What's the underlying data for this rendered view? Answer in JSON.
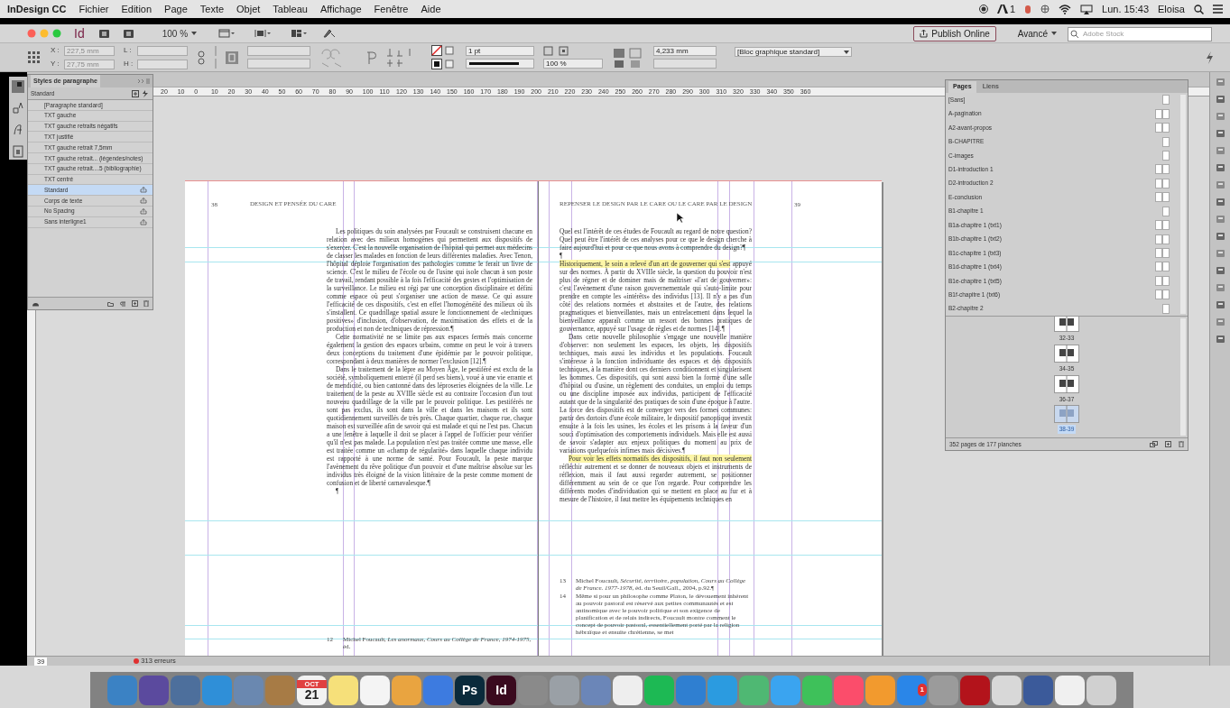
{
  "menubar": {
    "app": "InDesign CC",
    "items": [
      "Fichier",
      "Edition",
      "Page",
      "Texte",
      "Objet",
      "Tableau",
      "Affichage",
      "Fenêtre",
      "Aide"
    ],
    "badge": "1",
    "clock": "Lun. 15:43",
    "user": "Eloisa"
  },
  "titlebar": {
    "logo": "Id",
    "zoom": "100 %",
    "publish": "Publish Online",
    "workspace": "Avancé",
    "search": {
      "placeholder": "Adobe Stock"
    }
  },
  "control_panel": {
    "x": "227,5 mm",
    "y": "27,75 mm",
    "x_label": "X :",
    "y_label": "Y :",
    "w_label": "L :",
    "h_label": "H :",
    "stroke": "1 pt",
    "scale": "100 %",
    "offset": "4,233 mm",
    "object_style": "[Bloc graphique standard]"
  },
  "paragraph_styles": {
    "title": "Styles de paragraphe",
    "current": "Standard",
    "items": [
      {
        "label": "[Paragraphe standard]",
        "selected": false,
        "synced": false
      },
      {
        "label": "TXT gauche",
        "selected": false,
        "synced": false
      },
      {
        "label": "TXT gauche retraits négatifs",
        "selected": false,
        "synced": false
      },
      {
        "label": "TXT justifié",
        "selected": false,
        "synced": false
      },
      {
        "label": "TXT gauche retrait 7,5mm",
        "selected": false,
        "synced": false
      },
      {
        "label": "TXT gauche retrait... (légendes/notes)",
        "selected": false,
        "synced": false
      },
      {
        "label": "TXT gauche retrait....5 (bibliographie)",
        "selected": false,
        "synced": false
      },
      {
        "label": "TXT centré",
        "selected": false,
        "synced": false
      },
      {
        "label": "Standard",
        "selected": true,
        "synced": true
      },
      {
        "label": "Corps de texte",
        "selected": false,
        "synced": true
      },
      {
        "label": "No Spacing",
        "selected": false,
        "synced": true
      },
      {
        "label": "Sans interligne1",
        "selected": false,
        "synced": true
      }
    ]
  },
  "ruler": [
    "20",
    "10",
    "0",
    "10",
    "20",
    "30",
    "40",
    "50",
    "60",
    "70",
    "80",
    "90",
    "100",
    "110",
    "120",
    "130",
    "140",
    "150",
    "160",
    "170",
    "180",
    "190",
    "200",
    "210",
    "220",
    "230",
    "240",
    "250",
    "260",
    "270",
    "280",
    "290",
    "300",
    "310",
    "320",
    "330",
    "340",
    "350",
    "360"
  ],
  "spread": {
    "left": {
      "folio": "38",
      "running_head": "DESIGN ET PENSÉE DU CARE",
      "paragraphs": [
        {
          "text": "Les politiques du soin analysées par Foucault se construisent chacune en relation avec des milieux homogènes qui permettent aux dispositifs de s'exercer. C'est la nouvelle organisation de l'hôpital qui permet aux médecins de classer les malades en fonction de leurs différentes maladies. Avec Tenon, l'hôpital déploie l'organisation des pathologies comme le ferait un livre de science. C'est le milieu de l'école ou de l'usine qui isole chacun à son poste de travail, rendant possible à la fois l'efficacité des gestes et l'optimisation de la surveillance. Le milieu est régi par une conception disciplinaire et défini comme espace où peut s'organiser une action de masse. Ce qui assure l'efficacité de ces dispositifs, c'est en effet l'homogénéité des milieux où ils s'installent. Ce quadrillage spatial assure le fonctionnement de «techniques positives» d'inclusion, d'observation, de maximisation des effets et de la production et non de techniques de répression.¶"
        },
        {
          "text": "Cette normativité ne se limite pas aux espaces fermés mais concerne également la gestion des espaces urbains, comme on peut le voir à travers deux conceptions du traitement d'une épidémie par le pouvoir politique, correspondant à deux manières de normer l'exclusion [12].¶"
        },
        {
          "text": "Dans le traitement de la lèpre au Moyen Âge, le pestiféré est exclu de la société, symboliquement enterré (il perd ses biens), voué à une vie errante et de mendicité, ou bien cantonné dans des léproseries éloignées de la ville. Le traitement de la peste au XVIIIe siècle est au contraire l'occasion d'un tout nouveau quadrillage de la ville par le pouvoir politique. Les pestiférés ne sont pas exclus, ils sont dans la ville et dans les maisons et ils sont quotidiennement surveillés de très près. Chaque quartier, chaque rue, chaque maison est surveillée afin de savoir qui est malade et qui ne l'est pas. Chacun a une fenêtre à laquelle il doit se placer à l'appel de l'officier pour vérifier qu'il n'est pas malade. La population n'est pas traitée comme une masse, elle est traitée comme un «champ de régularité» dans laquelle chaque individu est rapporté à une norme de santé. Pour Foucault, la peste marque l'avènement du rêve politique d'un pouvoir et d'une maîtrise absolue sur les individus très éloigné de la vision littéraire de la peste comme moment de confusion et de liberté carnavalesque.¶"
        },
        {
          "text": "¶"
        }
      ],
      "footnotes": [
        {
          "number": "12",
          "text": "Michel Foucault, *Les anormaux, Cours au Collège de France, 1974-1975*, éd."
        }
      ]
    },
    "right": {
      "folio": "39",
      "running_head": "REPENSER LE DESIGN PAR LE CARE OU LE CARE PAR LE DESIGN",
      "paragraphs": [
        {
          "text": "Quel est l'intérêt de ces études de Foucault au regard de notre question? Quel peut être l'intérêt de ces analyses pour ce que le design cherche à faire aujourd'hui et pour ce que nous avons à comprendre du design?¶"
        },
        {
          "text": "¶"
        },
        {
          "lead": "Historiquement, le soin a relevé d'un art de gouverner qui s'est",
          "text": " appuyé sur des normes. À partir du XVIIIe siècle, la question du pouvoir n'est plus de régner et de dominer mais de maîtriser «l'art de gouverner»: c'est l'avènement d'une raison gouvernementale qui s'auto-limite pour prendre en compte les «intérêts» des individus [13]. Il n'y a pas d'un côté des relations normées et abstraites et de l'autre, des relations pragmatiques et bienveillantes, mais un entrelacement dans lequel la bienveillance apparaît comme un ressort des bonnes pratiques de gouvernance, appuyé sur l'usage de règles et de normes [14].¶"
        },
        {
          "text": "Dans cette nouvelle philosophie s'engage une nouvelle manière d'observer: non seulement les espaces, les objets, les dispositifs techniques, mais aussi les individus et les populations. Foucault s'intéresse à la fonction individuante des espaces et des dispositifs techniques, à la manière dont ces derniers conditionnent et singularisent les hommes. Ces dispositifs, qui sont aussi bien la forme d'une salle d'hôpital ou d'usine, un règlement des conduites, un emploi du temps ou une discipline imposée aux individus, participent de l'efficacité autant que de la singularité des pratiques de soin d'une époque à l'autre. La force des dispositifs est de converger vers des formes communes: partir des dortoirs d'une école militaire, le dispositif panoptique investit ensuite à la fois les usines, les écoles et les prisons à la faveur d'un souci d'optimisation des comportements individuels. Mais elle est aussi de savoir s'adapter aux enjeux politiques du moment au prix de variations quelquefois infimes mais décisives.¶"
        },
        {
          "lead": "Pour voir les effets normatifs des dispositifs, il faut non seulement",
          "text": " réfléchir autrement et se donner de nouveaux objets et instruments de réflexion, mais il faut aussi regarder autrement, se positionner différemment au sein de ce que l'on regarde. Pour comprendre les différents modes d'individuation qui se mettent en place au fur et à mesure de l'histoire, il faut mettre les équipements techniques en"
        }
      ],
      "footnotes": [
        {
          "number": "13",
          "text": "Michel Foucault, *Sécurité, territoire, population, Cours au Collège de France. 1977-1978*, éd. du Seuil/Gall., 2004, p.92.¶"
        },
        {
          "number": "14",
          "text": "Même si pour un philosophe comme Platon, le dévouement inhérent au pouvoir pastoral est réservé aux petites communautés et est antinomique avec le pouvoir politique et son exigence de planification et de relais indirects, Foucault montre comment le concept de pouvoir pastoral, essentiellement porté par la religion hébraïque et ensuite chrétienne, se met"
        }
      ]
    }
  },
  "pages_panel": {
    "tabs": [
      {
        "label": "Pages",
        "selected": true
      },
      {
        "label": "Liens",
        "selected": false
      }
    ],
    "masters": [
      {
        "label": "[Sans]",
        "kind": "single"
      },
      {
        "label": "A-pagination",
        "kind": "spread"
      },
      {
        "label": "A2-avant-propos",
        "kind": "spread"
      },
      {
        "label": "B-CHAPITRE",
        "kind": "single"
      },
      {
        "label": "C-images",
        "kind": "single"
      },
      {
        "label": "D1-introduction 1",
        "kind": "spread"
      },
      {
        "label": "D2-introduction 2",
        "kind": "spread"
      },
      {
        "label": "E-conclusion",
        "kind": "spread"
      },
      {
        "label": "B1-chapitre 1",
        "kind": "single"
      },
      {
        "label": "B1a-chapitre 1 (txt1)",
        "kind": "spread"
      },
      {
        "label": "B1b-chapitre 1 (txt2)",
        "kind": "spread"
      },
      {
        "label": "B1c-chapitre 1 (txt3)",
        "kind": "spread"
      },
      {
        "label": "B1d-chapitre 1 (txt4)",
        "kind": "spread"
      },
      {
        "label": "B1e-chapitre 1 (txt5)",
        "kind": "spread"
      },
      {
        "label": "B1f-chapitre 1 (txt6)",
        "kind": "spread"
      },
      {
        "label": "B2-chapitre 2",
        "kind": "single"
      }
    ],
    "spreads": [
      {
        "label": "32-33",
        "selected": false
      },
      {
        "label": "34-35",
        "selected": false
      },
      {
        "label": "36-37",
        "selected": false
      },
      {
        "label": "38-39",
        "selected": true
      }
    ],
    "summary": "352 pages de 177 planches"
  },
  "status_bar": {
    "page": "39",
    "errors": "313 erreurs"
  },
  "dock": [
    {
      "color": "#3b82c4"
    },
    {
      "color": "#5b4a9e"
    },
    {
      "color": "#4d6f9c"
    },
    {
      "color": "#2f8fd8"
    },
    {
      "color": "#6a88b0"
    },
    {
      "color": "#a77b45"
    },
    {
      "color": "#f2f2f2",
      "label": "21",
      "sub": "OCT"
    },
    {
      "color": "#f6e07a"
    },
    {
      "color": "#f4f4f4"
    },
    {
      "color": "#e9a440"
    },
    {
      "color": "#3d7be0"
    },
    {
      "color": "#0a2a3b",
      "label": "Ps"
    },
    {
      "color": "#3a0a1e",
      "label": "Id"
    },
    {
      "color": "#8a8a8a"
    },
    {
      "color": "#9aa0a6"
    },
    {
      "color": "#6b86b8"
    },
    {
      "color": "#eeeeee"
    },
    {
      "color": "#1db954"
    },
    {
      "color": "#2f7fd1"
    },
    {
      "color": "#2b9be0"
    },
    {
      "color": "#4fb873"
    },
    {
      "color": "#3aa4f0"
    },
    {
      "color": "#3ec15a"
    },
    {
      "color": "#fb4d6b"
    },
    {
      "color": "#f29a2e"
    },
    {
      "color": "#2a86e8",
      "label": "1"
    },
    {
      "color": "#9b9b9b"
    },
    {
      "color": "#b3131b"
    },
    {
      "color": "#d8d8d8"
    },
    {
      "color": "#3b5a9a"
    },
    {
      "color": "#f0f0f0"
    },
    {
      "color": "#d0d0d0"
    }
  ]
}
